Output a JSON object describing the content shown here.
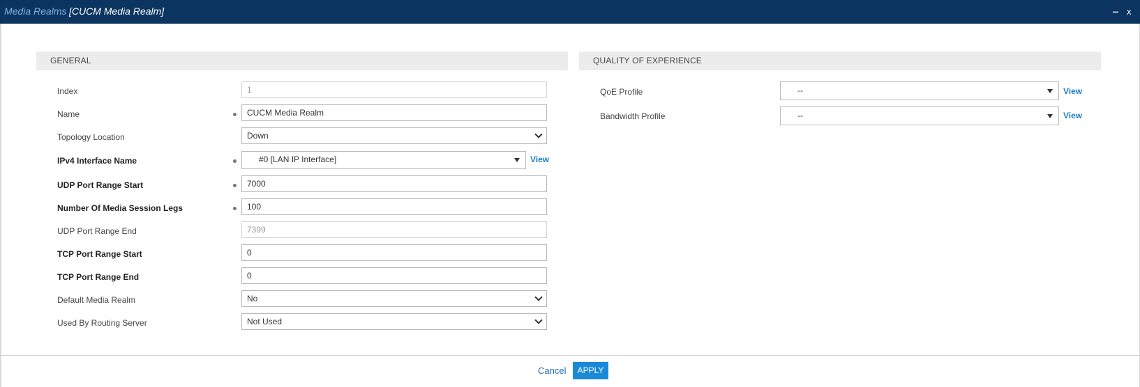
{
  "window": {
    "breadcrumb": "Media Realms",
    "title": "[CUCM Media Realm]",
    "minimize_glyph": "‒",
    "close_glyph": "x"
  },
  "general": {
    "header": "GENERAL",
    "fields": {
      "index": {
        "label": "Index",
        "value": "1"
      },
      "name": {
        "label": "Name",
        "value": "CUCM Media Realm"
      },
      "topology_location": {
        "label": "Topology Location",
        "value": "Down"
      },
      "ipv4_interface": {
        "label": "IPv4 Interface Name",
        "value": "#0 [LAN IP Interface]",
        "link": "View"
      },
      "udp_port_start": {
        "label": "UDP Port Range Start",
        "value": "7000"
      },
      "media_session_legs": {
        "label": "Number Of Media Session Legs",
        "value": "100"
      },
      "udp_port_end": {
        "label": "UDP Port Range End",
        "value": "7399"
      },
      "tcp_port_start": {
        "label": "TCP Port Range Start",
        "value": "0"
      },
      "tcp_port_end": {
        "label": "TCP Port Range End",
        "value": "0"
      },
      "default_media_realm": {
        "label": "Default Media Realm",
        "value": "No"
      },
      "used_by_routing_server": {
        "label": "Used By Routing Server",
        "value": "Not Used"
      }
    }
  },
  "qoe": {
    "header": "QUALITY OF EXPERIENCE",
    "fields": {
      "qoe_profile": {
        "label": "QoE Profile",
        "value": "--",
        "link": "View"
      },
      "bandwidth_profile": {
        "label": "Bandwidth Profile",
        "value": "--",
        "link": "View"
      }
    }
  },
  "footer": {
    "cancel_label": "Cancel",
    "apply_label": "APPLY"
  },
  "colors": {
    "titlebar_bg": "#0b3560",
    "breadcrumb": "#7fb2e6",
    "link": "#1f7dc4",
    "apply_bg": "#1a8ad8",
    "section_bg": "#ececec"
  }
}
